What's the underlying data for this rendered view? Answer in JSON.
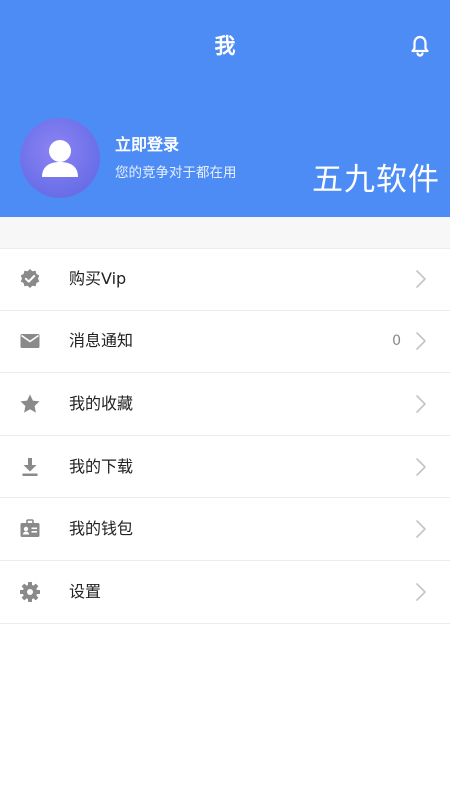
{
  "header": {
    "title": "我",
    "bell_icon": "bell-icon",
    "background_color": "#4d8cf5"
  },
  "profile": {
    "avatar_icon": "user-avatar-icon",
    "login_label": "立即登录",
    "subtitle": "您的竞争对于都在用"
  },
  "watermark": "五九软件",
  "menu": {
    "items": [
      {
        "label": "购买Vip",
        "icon": "verified-badge-icon",
        "badge": ""
      },
      {
        "label": "消息通知",
        "icon": "mail-icon",
        "badge": "0"
      },
      {
        "label": "我的收藏",
        "icon": "star-icon",
        "badge": ""
      },
      {
        "label": "我的下载",
        "icon": "download-icon",
        "badge": ""
      },
      {
        "label": "我的钱包",
        "icon": "wallet-card-icon",
        "badge": ""
      },
      {
        "label": "设置",
        "icon": "gear-icon",
        "badge": ""
      }
    ]
  }
}
